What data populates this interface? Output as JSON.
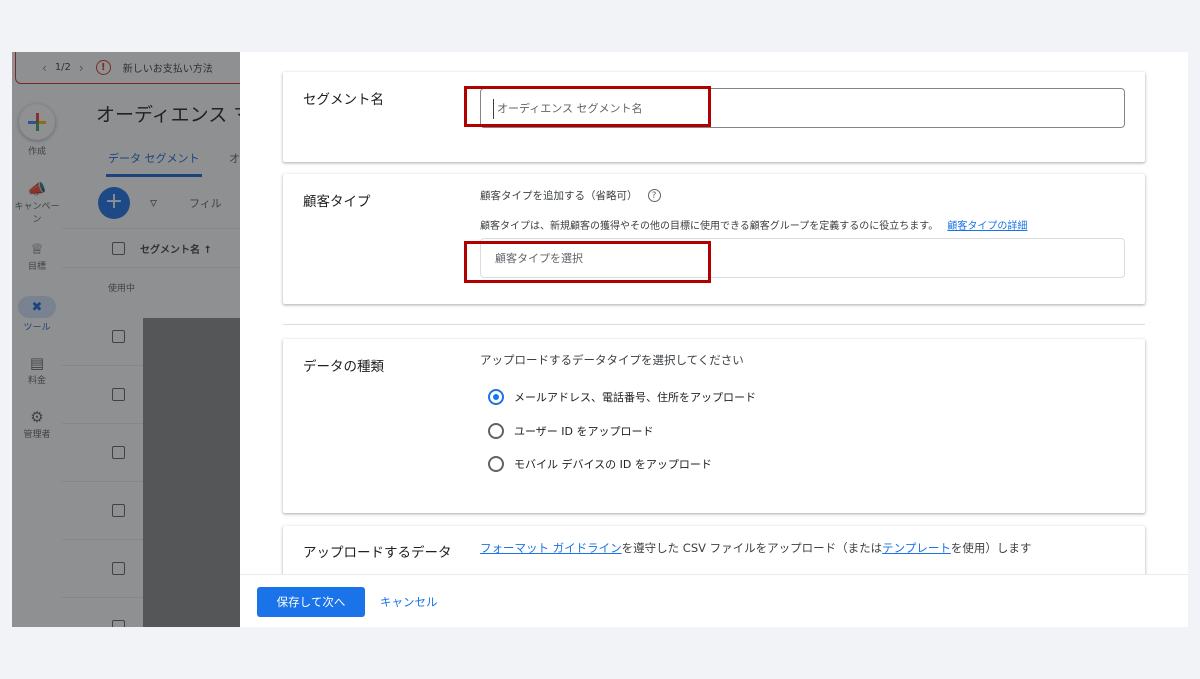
{
  "background_app": {
    "notification": {
      "count": "1/2",
      "text": "新しいお支払い方法"
    },
    "rail": {
      "create": "作成",
      "campaigns": "キャンペーン",
      "goals": "目標",
      "tools": "ツール",
      "billing": "料金",
      "admin": "管理者"
    },
    "page_title": "オーディエンス マ",
    "tabs": [
      "データ セグメント",
      "オ"
    ],
    "filter_label": "フィル",
    "table_header": {
      "segment_name": "セグメント名 ↑"
    },
    "in_use_label": "使用中"
  },
  "panel": {
    "segment_name": {
      "title": "セグメント名",
      "placeholder": "オーディエンス セグメント名"
    },
    "customer_type": {
      "title": "顧客タイプ",
      "add_label": "顧客タイプを追加する（省略可）",
      "description": "顧客タイプは、新規顧客の獲得やその他の目標に使用できる顧客グループを定義するのに役立ちます。",
      "details_link": "顧客タイプの詳細",
      "select_placeholder": "顧客タイプを選択"
    },
    "data_type": {
      "title": "データの種類",
      "prompt": "アップロードするデータタイプを選択してください",
      "options": [
        {
          "label": "メールアドレス、電話番号、住所をアップロード",
          "checked": true
        },
        {
          "label": "ユーザー ID をアップロード",
          "checked": false
        },
        {
          "label": "モバイル デバイスの ID をアップロード",
          "checked": false
        }
      ]
    },
    "upload": {
      "title": "アップロードするデータ",
      "link1": "フォーマット ガイドライン",
      "text1": "を遵守した CSV ファイルをアップロード（または",
      "link2": "テンプレート",
      "text2": "を使用）します"
    }
  },
  "footer": {
    "save_label": "保存して次へ",
    "cancel_label": "キャンセル"
  },
  "colors": {
    "primary": "#1a73e8",
    "highlight_box": "#b00000",
    "alert": "#d93025"
  }
}
